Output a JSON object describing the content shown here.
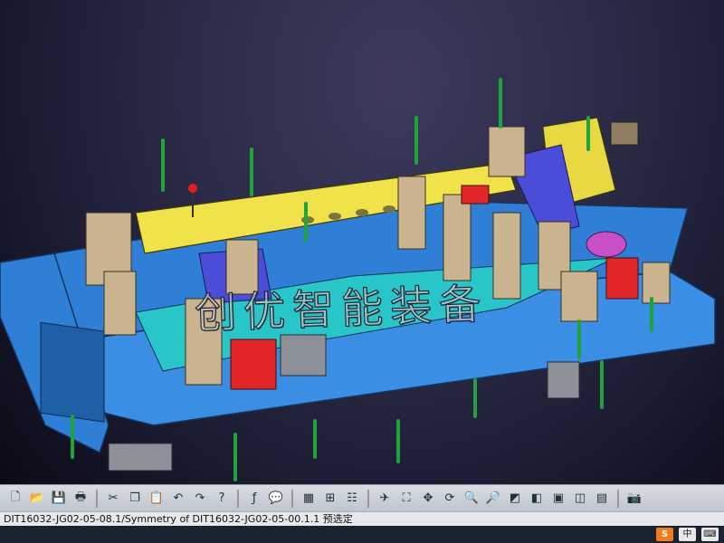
{
  "app": {
    "watermark": "创优智能装备"
  },
  "toolbar": {
    "icons": [
      "new-file-icon",
      "open-folder-icon",
      "save-icon",
      "print-icon",
      "cut-icon",
      "copy-icon",
      "paste-icon",
      "undo-icon",
      "redo-icon",
      "whats-this-icon",
      "formula-icon",
      "comment-icon",
      "table-icon",
      "tree-icon",
      "publication-icon",
      "fly-mode-icon",
      "fit-all-icon",
      "pan-icon",
      "rotate-icon",
      "zoom-in-icon",
      "zoom-out-icon",
      "normal-view-icon",
      "iso-view-icon",
      "shading-icon",
      "hide-show-icon",
      "swap-visible-icon",
      "capture-icon"
    ]
  },
  "status": {
    "text": "DIT16032-JG02-05-08.1/Symmetry of DIT16032-JG02-05-00.1.1 预选定"
  },
  "taskbar": {
    "ime_brand": "S",
    "ime_lang": "中"
  }
}
